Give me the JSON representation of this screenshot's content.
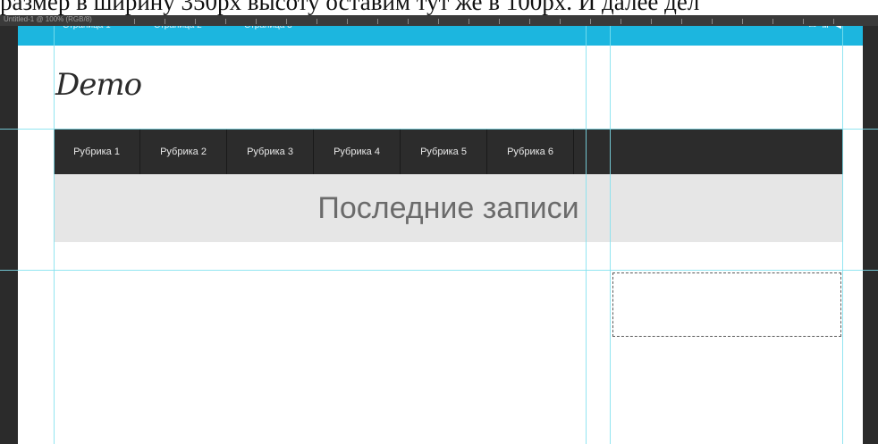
{
  "caption": "размер в ширину 350px высоту оставим тут же в 100px. И далее дел",
  "ps_ruler": {
    "label": "Untitled-1 @ 100% (RGB/8)"
  },
  "topbar": {
    "links": [
      "Страница 1",
      "Страница 2",
      "Страница 3"
    ],
    "social": "✉ ᴍ ◀",
    "color": "#1cb6df"
  },
  "logo": "Demo",
  "menu": {
    "items": [
      "Рубрика 1",
      "Рубрика 2",
      "Рубрика 3",
      "Рубрика 4",
      "Рубрика 5",
      "Рубрика 6"
    ],
    "color": "#2c2c2c"
  },
  "banner": {
    "title": "Последние записи"
  },
  "colors": {
    "canvas": "#2b2b2b",
    "guide": "#7fe0ef",
    "banner": "#e6e6e6"
  }
}
